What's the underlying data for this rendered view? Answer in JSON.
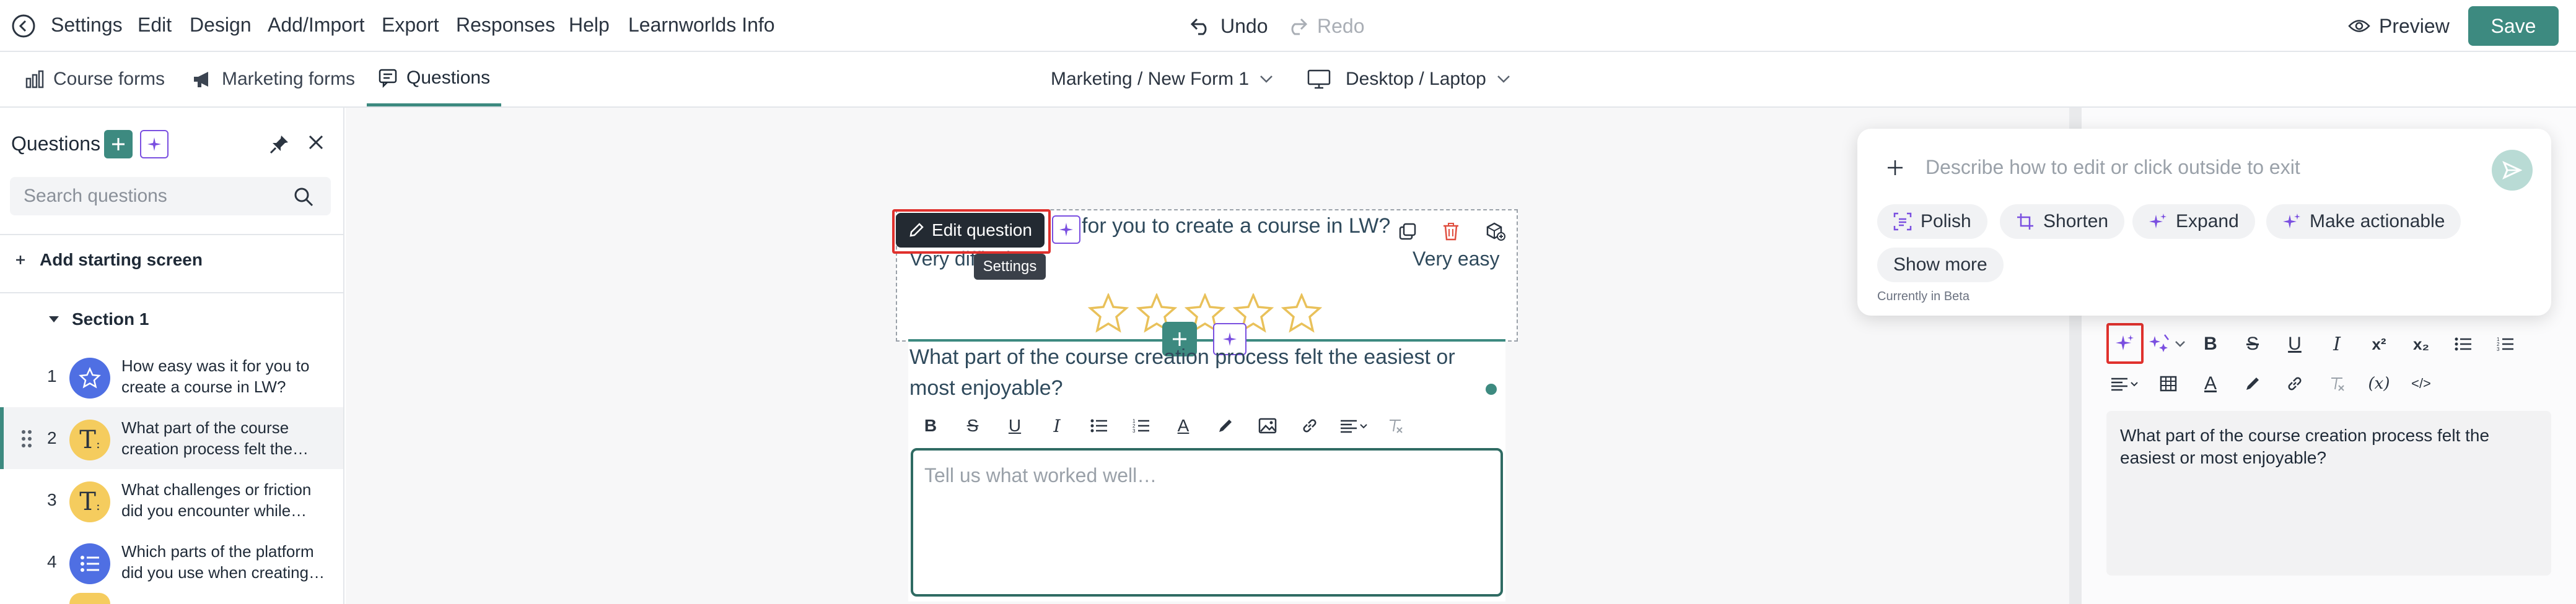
{
  "topbar": {
    "menu": [
      "Settings",
      "Edit",
      "Design",
      "Add/Import",
      "Export",
      "Responses",
      "Help",
      "Learnworlds Info"
    ],
    "undo": "Undo",
    "redo": "Redo",
    "preview": "Preview",
    "save": "Save"
  },
  "tabs": {
    "items": [
      "Course forms",
      "Marketing forms",
      "Questions"
    ],
    "active": "Questions",
    "breadcrumb": "Marketing / New Form 1",
    "device": "Desktop / Laptop"
  },
  "sidebar": {
    "title": "Questions",
    "search_placeholder": "Search questions",
    "add_starting_screen": "Add starting screen",
    "section": "Section 1",
    "questions": [
      {
        "num": "1",
        "text": "How easy was it for you to create a course in LW?",
        "icon": "star-icon",
        "color": "#4f6fe3"
      },
      {
        "num": "2",
        "text": "What part of the course creation process felt the…",
        "icon": "text-icon",
        "color": "#f5cc5e"
      },
      {
        "num": "3",
        "text": "What challenges or friction did you encounter while…",
        "icon": "text-icon",
        "color": "#f5cc5e"
      },
      {
        "num": "4",
        "text": "Which parts of the platform did you use when creating…",
        "icon": "list-icon",
        "color": "#4f6fe3"
      }
    ]
  },
  "canvas": {
    "prev_question": "for you to create a course in LW?",
    "scale_low": "Very difficult",
    "scale_high": "Very easy",
    "edit_question": "Edit question",
    "settings_tooltip": "Settings",
    "current_question": "What part of the course creation process felt the easiest or most enjoyable?",
    "answer_placeholder": "Tell us what worked well…"
  },
  "ai_popover": {
    "placeholder": "Describe how to edit or click outside to exit",
    "chips": [
      "Polish",
      "Shorten",
      "Expand",
      "Make actionable"
    ],
    "show_more": "Show more",
    "beta": "Currently in Beta"
  },
  "right_panel": {
    "editor_text": "What part of the course creation process felt the easiest or most enjoyable?"
  },
  "colors": {
    "accent": "#3d8a80",
    "ai_purple": "#7a4fe0",
    "highlight_red": "#e0312d"
  }
}
